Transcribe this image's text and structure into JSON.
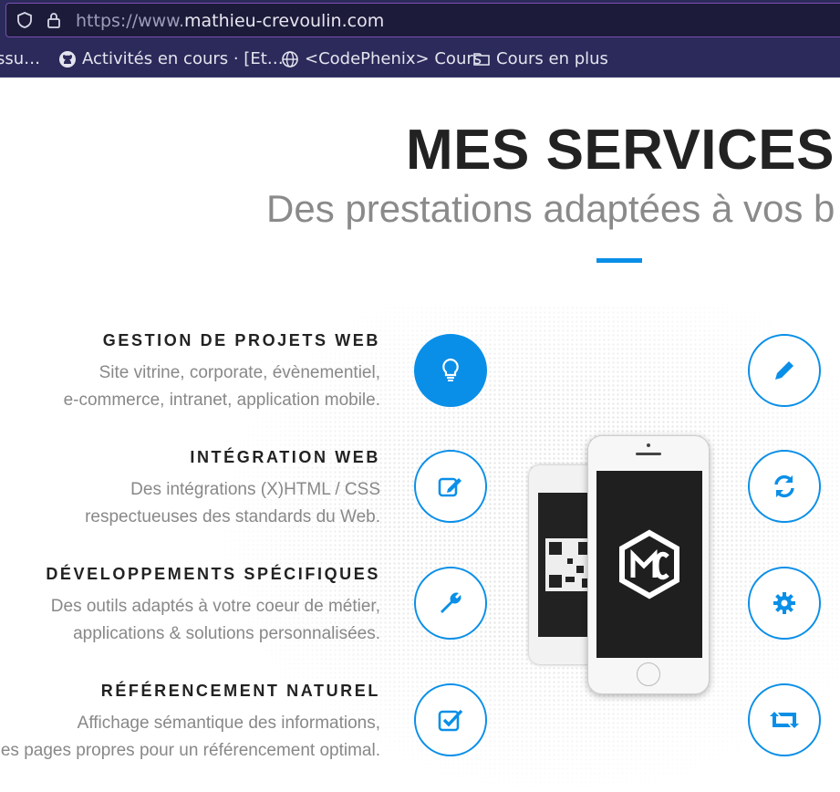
{
  "browser": {
    "url_prefix": "https://www.",
    "url_host": "mathieu-crevoulin.com",
    "bookmarks": [
      {
        "label": "ssu…",
        "icon": "folder-icon"
      },
      {
        "label": "Activités en cours · [Et…",
        "icon": "github-icon"
      },
      {
        "label": "<CodePhenix> Cours",
        "icon": "globe-icon"
      },
      {
        "label": "Cours en plus",
        "icon": "folder-icon"
      }
    ]
  },
  "page": {
    "title": "MES SERVICES",
    "subtitle": "Des prestations adaptées à vos b",
    "accent_color": "#0a8fe8"
  },
  "services": [
    {
      "title": "GESTION DE PROJETS WEB",
      "line1": "Site vitrine, corporate, évènementiel,",
      "line2": "e-commerce, intranet, application mobile.",
      "icon": "lightbulb-icon"
    },
    {
      "title": "INTÉGRATION WEB",
      "line1": "Des intégrations (X)HTML / CSS",
      "line2": "respectueuses des standards du Web.",
      "icon": "edit-icon"
    },
    {
      "title": "DÉVELOPPEMENTS SPÉCIFIQUES",
      "line1": "Des outils adaptés à votre coeur de métier,",
      "line2": "applications & solutions personnalisées.",
      "icon": "wrench-icon"
    },
    {
      "title": "RÉFÉRENCEMENT NATUREL",
      "line1": "Affichage sémantique des informations,",
      "line2": "des pages propres pour un référencement optimal.",
      "icon": "checkbox-icon"
    }
  ],
  "right_icons": [
    "pencil-icon",
    "refresh-icon",
    "gear-icon",
    "retweet-icon"
  ]
}
